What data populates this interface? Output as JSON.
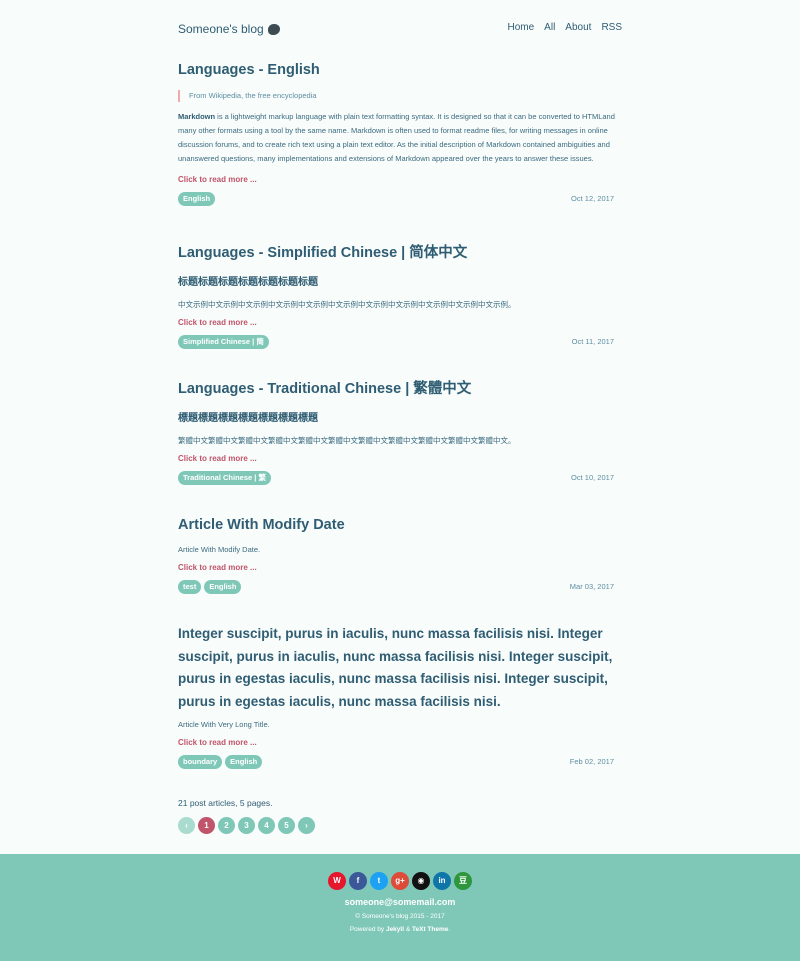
{
  "header": {
    "brand": "Someone's blog",
    "brand_icon": "blob-icon",
    "nav": [
      "Home",
      "All",
      "About",
      "RSS"
    ]
  },
  "posts": [
    {
      "title": "Languages - English",
      "quote": "From Wikipedia, the free encyclopedia",
      "excerpt_bold": "Markdown",
      "excerpt": " is a lightweight markup language with plain text formatting syntax. It is designed so that it can be converted to HTMLand many other formats using a tool by the same name. Markdown is often used to format readme files, for writing messages in online discussion forums, and to create rich text using a plain text editor. As the initial description of Markdown contained ambiguities and unanswered questions, many implementations and extensions of Markdown appeared over the years to answer these issues.",
      "read_more": "Click to read more ...",
      "tags": [
        "English"
      ],
      "date": "Oct 12, 2017"
    },
    {
      "title": "Languages - Simplified Chinese | 简体中文",
      "subhead": "标题标题标题标题标题标题标题",
      "excerpt": "中文示例中文示例中文示例中文示例中文示例中文示例中文示例中文示例中文示例中文示例中文示例。",
      "read_more": "Click to read more ...",
      "tags": [
        "Simplified Chinese | 简"
      ],
      "date": "Oct 11, 2017"
    },
    {
      "title": "Languages - Traditional Chinese | 繁體中文",
      "subhead": "標題標題標題標題標題標題標題",
      "excerpt": "繁體中文繁體中文繁體中文繁體中文繁體中文繁體中文繁體中文繁體中文繁體中文繁體中文繁體中文。",
      "read_more": "Click to read more ...",
      "tags": [
        "Traditional Chinese | 繁"
      ],
      "date": "Oct 10, 2017"
    },
    {
      "title": "Article With Modify Date",
      "excerpt": "Article With Modify Date.",
      "read_more": "Click to read more ...",
      "tags": [
        "test",
        "English"
      ],
      "date": "Mar 03, 2017"
    },
    {
      "title": "Integer suscipit, purus in iaculis, nunc massa facilisis nisi. Integer suscipit, purus in iaculis, nunc massa facilisis nisi. Integer suscipit, purus in egestas iaculis, nunc massa facilisis nisi. Integer suscipit, purus in egestas iaculis, nunc massa facilisis nisi.",
      "excerpt": "Article With Very Long Title.",
      "read_more": "Click to read more ...",
      "tags": [
        "boundary",
        "English"
      ],
      "date": "Feb 02, 2017"
    }
  ],
  "pagination": {
    "summary": "21 post articles, 5 pages.",
    "prev": "‹",
    "next": "›",
    "pages": [
      "1",
      "2",
      "3",
      "4",
      "5"
    ],
    "current": "1"
  },
  "footer": {
    "social": [
      {
        "icon": "weibo-icon",
        "glyph": "W",
        "color": "#e6162d"
      },
      {
        "icon": "facebook-icon",
        "glyph": "f",
        "color": "#3b5998"
      },
      {
        "icon": "twitter-icon",
        "glyph": "t",
        "color": "#1da1f2"
      },
      {
        "icon": "google-plus-icon",
        "glyph": "g+",
        "color": "#dd4b39"
      },
      {
        "icon": "github-icon",
        "glyph": "◉",
        "color": "#111111"
      },
      {
        "icon": "linkedin-icon",
        "glyph": "in",
        "color": "#0e76a8"
      },
      {
        "icon": "douban-icon",
        "glyph": "豆",
        "color": "#2e963d"
      }
    ],
    "email": "someone@somemail.com",
    "copyright": "© Someone's blog 2015 - 2017",
    "powered_prefix": "Powered by",
    "jekyll": "Jekyll",
    "amp": "&",
    "theme": "TeXt Theme",
    "period": "."
  }
}
